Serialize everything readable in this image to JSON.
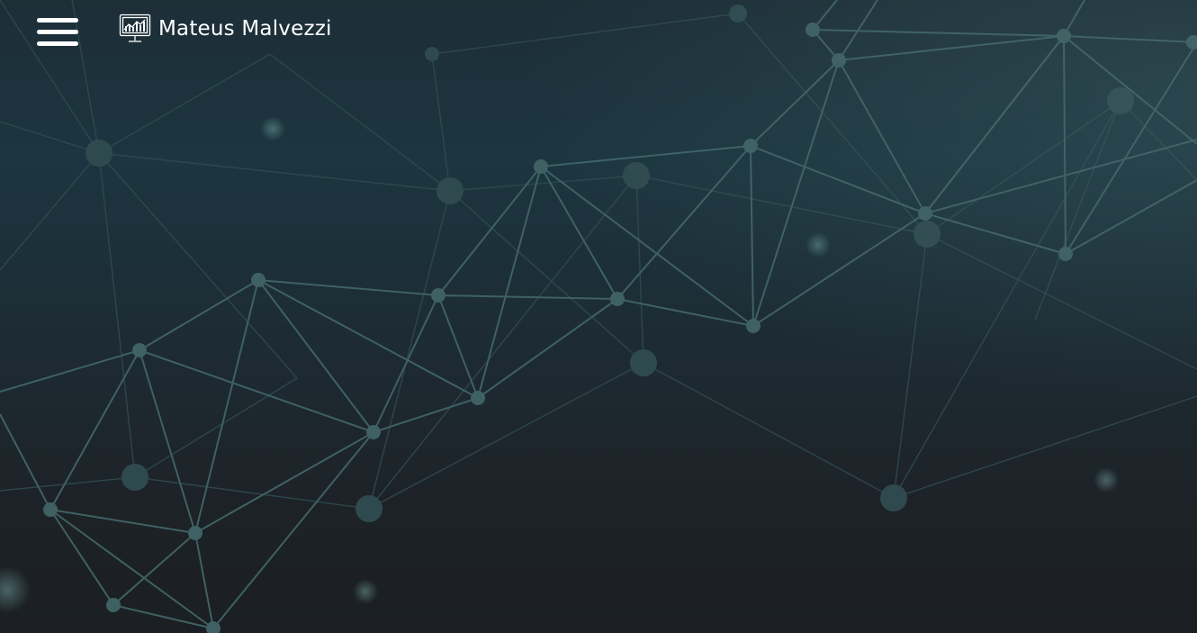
{
  "header": {
    "menu_icon": "hamburger-menu-icon",
    "logo_icon": "monitor-chart-icon",
    "brand_name": "Mateus Malvezzi"
  },
  "colors": {
    "background_top": "#1c3540",
    "background_bottom": "#1b1f23",
    "network_line": "#3f6164",
    "network_node": "#3f6164",
    "text": "#ffffff"
  }
}
